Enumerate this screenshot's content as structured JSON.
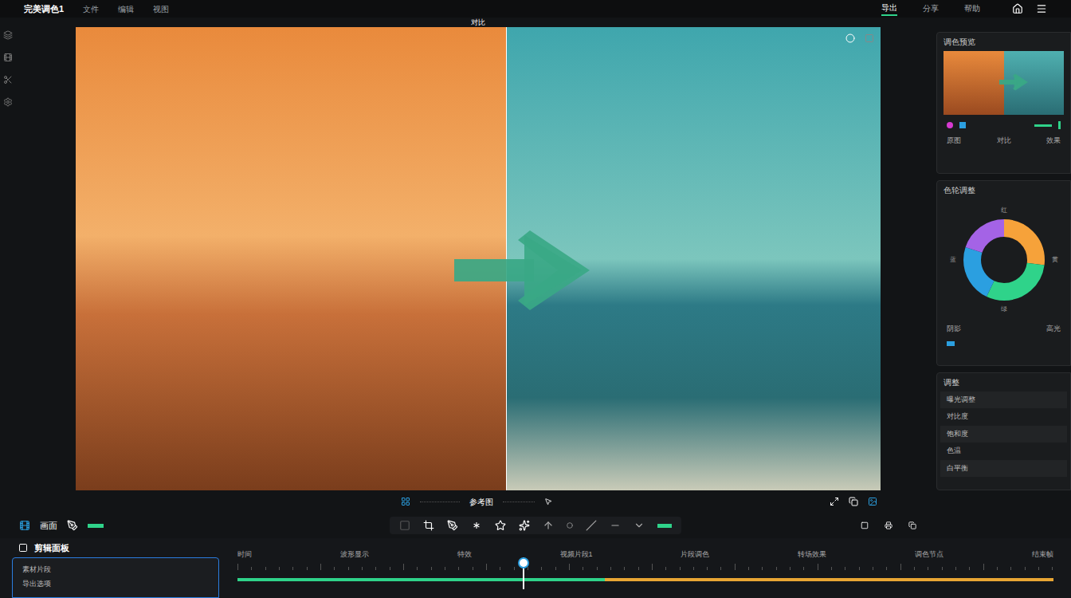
{
  "window": {
    "title": "完美调色1"
  },
  "menu": [
    "文件",
    "编辑",
    "视图"
  ],
  "top_actions": [
    {
      "label": "导出",
      "selected": true
    },
    {
      "label": "分享",
      "selected": false
    },
    {
      "label": "帮助",
      "selected": false
    }
  ],
  "preview": {
    "label": "对比",
    "split": 0.535
  },
  "side_panel": {
    "thumbnail": {
      "title": "调色预览",
      "controls": [
        "原图",
        "对比",
        "效果"
      ]
    },
    "color": {
      "title": "色轮调整",
      "labels": {
        "top": "红",
        "left": "蓝",
        "right": "黄",
        "bottom": "绿"
      },
      "footer": [
        "阴影",
        "高光"
      ]
    },
    "adjust": {
      "title": "调整",
      "items": [
        "曝光调整",
        "对比度",
        "饱和度",
        "色温",
        "白平衡"
      ]
    }
  },
  "caption": "参考图",
  "toolbar": {
    "label": "画面"
  },
  "editor_panel": {
    "title": "剪辑面板",
    "items": [
      "素材片段",
      "导出选项"
    ]
  },
  "timeline": {
    "labels": [
      "时间",
      "波形显示",
      "特效",
      "视频片段1",
      "片段调色",
      "转场效果",
      "调色节点",
      "结束帧"
    ],
    "playhead": 0.35,
    "graded": 0.45
  }
}
